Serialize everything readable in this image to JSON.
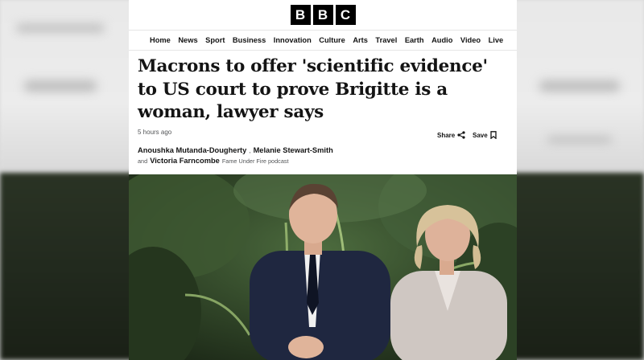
{
  "brand": {
    "logo_letters": [
      "B",
      "B",
      "C"
    ]
  },
  "nav": {
    "items": [
      "Home",
      "News",
      "Sport",
      "Business",
      "Innovation",
      "Culture",
      "Arts",
      "Travel",
      "Earth",
      "Audio",
      "Video",
      "Live"
    ]
  },
  "article": {
    "headline": "Macrons to offer 'scientific evidence' to US court to prove Brigitte is a woman, lawyer says",
    "timestamp": "5 hours ago",
    "share_label": "Share",
    "save_label": "Save",
    "authors": {
      "first": "Anoushka Mutanda-Dougherty",
      "separator": ",",
      "second": "Melanie Stewart-Smith",
      "and_label": "and",
      "third": "Victoria Farncombe",
      "third_role": "Fame Under Fire podcast"
    }
  },
  "icons": {
    "share": "share-icon",
    "save": "bookmark-icon"
  },
  "colors": {
    "text": "#141414",
    "muted": "#545658",
    "logo_bg": "#000000"
  }
}
